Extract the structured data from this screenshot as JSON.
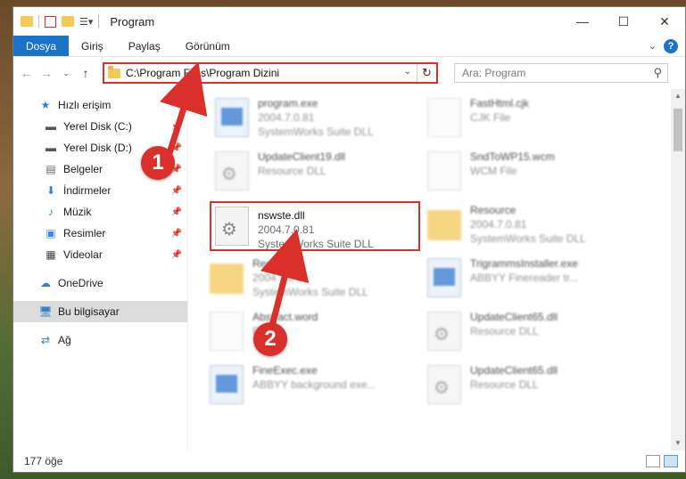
{
  "window": {
    "title": "Program",
    "minimize": "—",
    "maximize": "☐",
    "close": "✕"
  },
  "ribbon": {
    "tabs": [
      {
        "label": "Dosya",
        "active": true
      },
      {
        "label": "Giriş"
      },
      {
        "label": "Paylaş"
      },
      {
        "label": "Görünüm"
      }
    ]
  },
  "address": {
    "path": "C:\\Program Files\\Program Dizini"
  },
  "search": {
    "placeholder": "Ara: Program"
  },
  "nav": {
    "items": [
      {
        "label": "Hızlı erişim",
        "icon": "star-icon"
      },
      {
        "label": "Yerel Disk (C:)",
        "icon": "drive-icon"
      },
      {
        "label": "Yerel Disk (D:)",
        "icon": "drive-icon"
      },
      {
        "label": "Belgeler",
        "icon": "document-icon"
      },
      {
        "label": "İndirmeler",
        "icon": "download-icon"
      },
      {
        "label": "Müzik",
        "icon": "music-icon"
      },
      {
        "label": "Resimler",
        "icon": "pictures-icon"
      },
      {
        "label": "Videolar",
        "icon": "video-icon"
      },
      {
        "label": "OneDrive",
        "icon": "cloud-icon"
      },
      {
        "label": "Bu bilgisayar",
        "icon": "computer-icon"
      },
      {
        "label": "Ağ",
        "icon": "network-icon"
      }
    ]
  },
  "files": [
    {
      "name": "program.exe",
      "line2": "2004.7.0.81",
      "line3": "SystemWorks Suite DLL"
    },
    {
      "name": "FastHtml.cjk",
      "line2": "CJK File",
      "line3": ""
    },
    {
      "name": "UpdateClient19.dll",
      "line2": "Resource DLL",
      "line3": ""
    },
    {
      "name": "SndToWP15.wcm",
      "line2": "WCM File",
      "line3": ""
    },
    {
      "name": "nswste.dll",
      "line2": "2004.7.0.81",
      "line3": "SystemWorks Suite DLL"
    },
    {
      "name": "Resource",
      "line2": "2004.7.0.81",
      "line3": "SystemWorks Suite DLL"
    },
    {
      "name": "Resource",
      "line2": "2004.7.0.81",
      "line3": "SystemWorks Suite DLL"
    },
    {
      "name": "TrigrammsInstaller.exe",
      "line2": "ABBYY Finereader tr...",
      "line3": ""
    },
    {
      "name": "Abstract.word",
      "line2": "File",
      "line3": ""
    },
    {
      "name": "UpdateClient65.dll",
      "line2": "Resource DLL",
      "line3": ""
    },
    {
      "name": "FineExec.exe",
      "line2": "ABBYY background exe...",
      "line3": ""
    },
    {
      "name": "UpdateClient65.dll",
      "line2": "Resource DLL",
      "line3": ""
    }
  ],
  "status": {
    "count": "177 öğe"
  },
  "annotations": {
    "step1": "1",
    "step2": "2",
    "color": "#d9302b"
  }
}
